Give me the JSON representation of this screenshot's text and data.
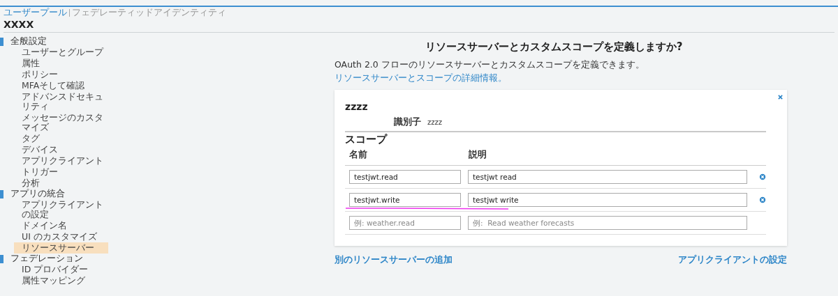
{
  "header": {
    "tabs": [
      {
        "label": "ユーザープール",
        "selected": true
      },
      {
        "label": "フェデレーティッドアイデンティティ",
        "selected": false
      }
    ],
    "pool_name": "XXXX"
  },
  "sidebar": {
    "groups": [
      {
        "label": "全般設定",
        "items": [
          {
            "label": "ユーザーとグループ",
            "selected": false
          },
          {
            "label": "属性",
            "selected": false
          },
          {
            "label": "ポリシー",
            "selected": false
          },
          {
            "label": "MFAそして確認",
            "selected": false
          },
          {
            "label": "アドバンスドセキュリティ",
            "selected": false
          },
          {
            "label": "メッセージのカスタマイズ",
            "selected": false
          },
          {
            "label": "タグ",
            "selected": false
          },
          {
            "label": "デバイス",
            "selected": false
          },
          {
            "label": "アプリクライアント",
            "selected": false
          },
          {
            "label": "トリガー",
            "selected": false
          },
          {
            "label": "分析",
            "selected": false
          }
        ]
      },
      {
        "label": "アプリの統合",
        "items": [
          {
            "label": "アプリクライアントの設定",
            "selected": false
          },
          {
            "label": "ドメイン名",
            "selected": false
          },
          {
            "label": "UI のカスタマイズ",
            "selected": false
          },
          {
            "label": "リソースサーバー",
            "selected": true
          }
        ]
      },
      {
        "label": "フェデレーション",
        "items": [
          {
            "label": "ID プロバイダー",
            "selected": false
          },
          {
            "label": "属性マッピング",
            "selected": false
          }
        ]
      }
    ]
  },
  "main": {
    "title": "リソースサーバーとカスタムスコープを定義しますか?",
    "intro": "OAuth 2.0 フローのリソースサーバーとカスタムスコープを定義できます。",
    "intro_link": "リソースサーバーとスコープの詳細情報。",
    "server": {
      "name": "zzzz",
      "identifier_label": "識別子",
      "identifier": "zzzz",
      "scopes_heading": "スコープ",
      "columns": [
        "名前",
        "説明"
      ],
      "rows": [
        {
          "kind": "scope",
          "name": "testjwt.read",
          "description": "testjwt read",
          "underlined": false
        },
        {
          "kind": "scope",
          "name": "testjwt.write",
          "description": "testjwt write",
          "underlined": true
        },
        {
          "kind": "new",
          "name_placeholder": "例: weather.read",
          "description_placeholder": "例:  Read weather forecasts",
          "underlined": false
        }
      ]
    },
    "add_link": "別のリソースサーバーの追加",
    "next_link": "アプリクライアントの設定"
  }
}
